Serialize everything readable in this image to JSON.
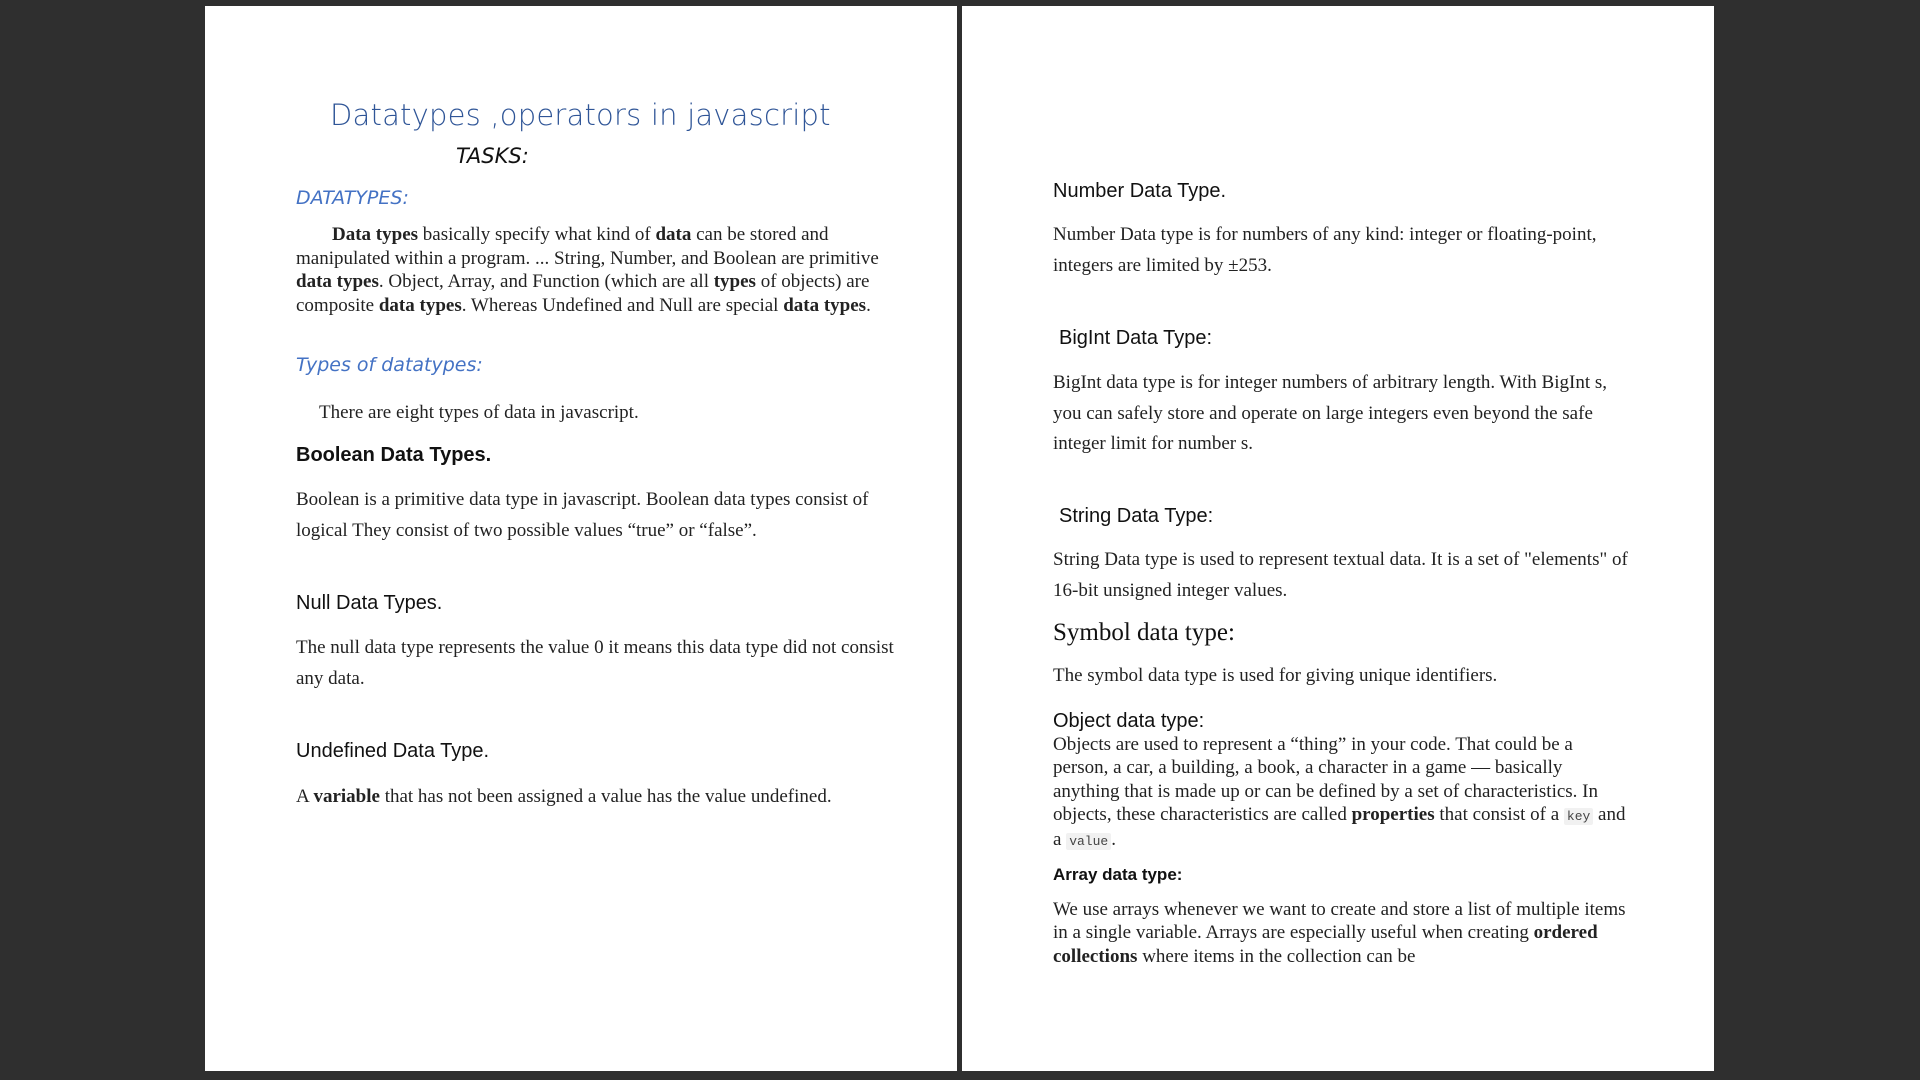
{
  "pages": {
    "left": {
      "title": "Datatypes ,operators in javascript",
      "subtitle": "TASKS:",
      "datatypes_heading": "DATATYPES:",
      "intro": {
        "s1_bold": "Data types",
        "s2": " basically specify what kind of ",
        "s3_bold": "data",
        "s4": " can be stored and manipulated within a program. ... String, Number, and Boolean are primitive ",
        "s5_bold": "data types",
        "s6": ". Object, Array, and Function (which are all ",
        "s7_bold": "types",
        "s8": " of objects) are composite ",
        "s9_bold": "data types",
        "s10": ". Whereas Undefined and Null are special ",
        "s11_bold": "data types",
        "s12": "."
      },
      "types_heading": "Types of datatypes:",
      "eight_types_text": "There are eight types of data in javascript.",
      "boolean_heading": "Boolean Data Types.",
      "boolean_text": "Boolean is a primitive data type in javascript. Boolean data types consist of logical They consist of two possible values “true” or “false”.",
      "null_heading": "Null Data Types.",
      "null_text": "The null data type represents the value 0 it means this data type did not consist any data.",
      "undefined_heading": "Undefined Data Type.",
      "undefined_text": {
        "s1": "A ",
        "s2_bold": "variable",
        "s3": " that has not been assigned a value has the value undefined."
      }
    },
    "right": {
      "number_heading": "Number Data Type.",
      "number_text": "Number Data type is for numbers of any kind: integer or floating-point, integers are limited by ±253.",
      "bigint_heading": "BigInt Data Type:",
      "bigint_text": "BigInt data type is for integer numbers of arbitrary length. With BigInt s, you can safely store and operate on large integers even beyond the safe integer limit for number s.",
      "string_heading": "String Data Type:",
      "string_text": "String Data type is used to represent textual data. It is a set of \"elements\" of 16-bit unsigned integer values.",
      "symbol_heading": "Symbol data type:",
      "symbol_text": "The symbol data type is used for giving unique identifiers.",
      "object_heading": "Object data type:",
      "object_text": {
        "s1": "Objects are used to represent a “thing” in your code. That could be a person, a car, a building, a book, a character in a game — basically anything that is made up or can be defined by a set of characteristics. In objects, these characteristics are called ",
        "s2_bold": "properties",
        "s3": " that consist of a ",
        "code_key": "key",
        "s4": " and a ",
        "code_value": "value",
        "s5": "."
      },
      "array_heading": "Array data type:",
      "array_text": {
        "s1": "We use arrays whenever we want to create and store a list of multiple items in a single variable. Arrays are especially useful when creating ",
        "s2_bold": "ordered collections",
        "s3": " where items in the collection can be"
      }
    }
  },
  "colors": {
    "viewer_background": "#2f2f2f",
    "page_background": "#ffffff",
    "title_blue": "#2f5597",
    "heading_blue": "#4472c4"
  }
}
